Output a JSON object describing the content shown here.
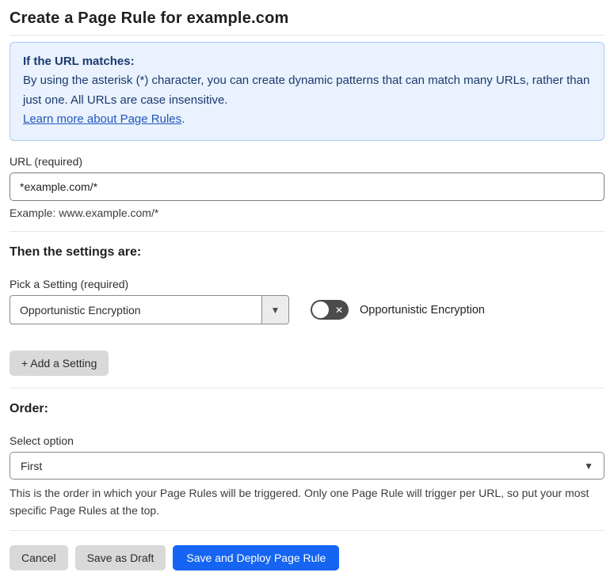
{
  "page": {
    "title": "Create a Page Rule for example.com"
  },
  "info_box": {
    "heading": "If the URL matches:",
    "body": "By using the asterisk (*) character, you can create dynamic patterns that can match many URLs, rather than just one. All URLs are case insensitive.",
    "link_label": "Learn more about Page Rules",
    "link_suffix": "."
  },
  "url_section": {
    "label": "URL (required)",
    "value": "*example.com/*",
    "example": "Example: www.example.com/*"
  },
  "settings_section": {
    "heading": "Then the settings are:",
    "pick_label": "Pick a Setting (required)",
    "selected_setting": "Opportunistic Encryption",
    "toggle_label": "Opportunistic Encryption",
    "toggle_state": "off",
    "add_setting_label": "+ Add a Setting"
  },
  "order_section": {
    "heading": "Order:",
    "select_label": "Select option",
    "selected_option": "First",
    "help_text": "This is the order in which your Page Rules will be triggered. Only one Page Rule will trigger per URL, so put your most specific Page Rules at the top."
  },
  "footer": {
    "cancel_label": "Cancel",
    "save_draft_label": "Save as Draft",
    "save_deploy_label": "Save and Deploy Page Rule"
  },
  "icons": {
    "x_glyph": "✕",
    "caret_glyph": "▼"
  },
  "colors": {
    "info_bg": "#e9f2fe",
    "info_border": "#abcaf2",
    "info_text": "#1b3a6e",
    "link": "#2356bd",
    "primary_button": "#1565f2",
    "toggle_off": "#4b4b4b",
    "secondary_button": "#d9d9d9"
  }
}
